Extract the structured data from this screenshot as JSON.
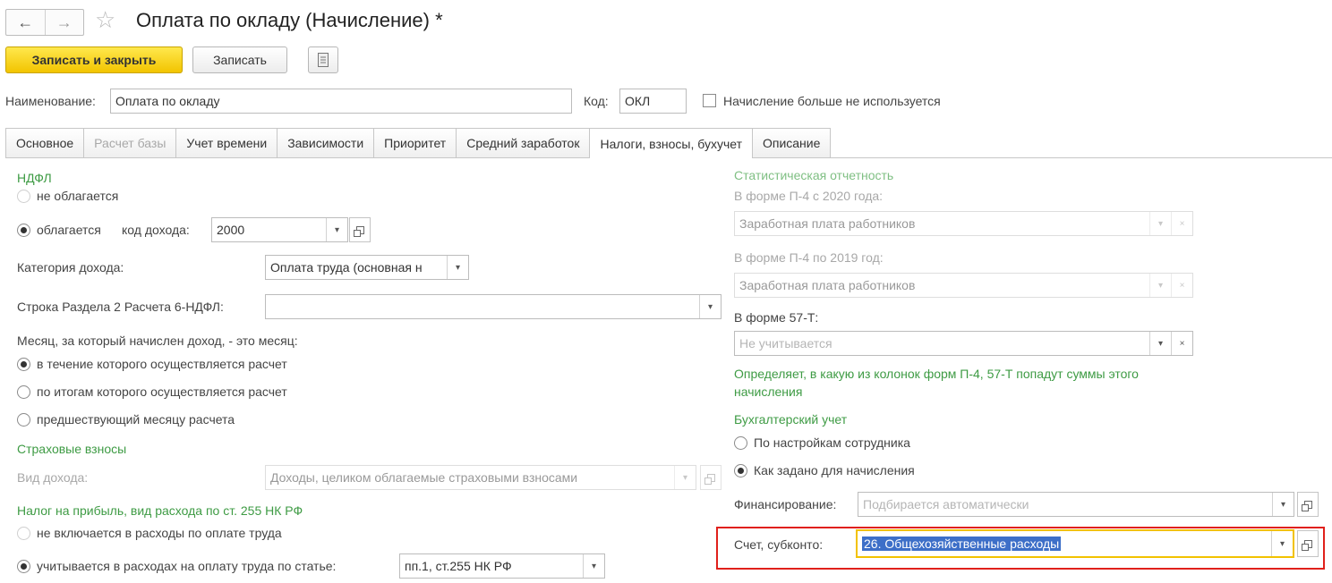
{
  "header": {
    "back_glyph": "←",
    "forward_glyph": "→",
    "star_glyph": "☆",
    "title": "Оплата по окладу (Начисление) *"
  },
  "toolbar": {
    "save_close_label": "Записать и закрыть",
    "save_label": "Записать",
    "more_icon": "document-list-icon"
  },
  "form": {
    "name_label": "Наименование:",
    "name_value": "Оплата по окладу",
    "code_label": "Код:",
    "code_value": "ОКЛ",
    "unused_label": "Начисление больше не используется"
  },
  "tabs": [
    {
      "label": "Основное"
    },
    {
      "label": "Расчет базы"
    },
    {
      "label": "Учет времени"
    },
    {
      "label": "Зависимости"
    },
    {
      "label": "Приоритет"
    },
    {
      "label": "Средний заработок"
    },
    {
      "label": "Налоги, взносы, бухучет"
    },
    {
      "label": "Описание"
    }
  ],
  "left": {
    "ndfl_title": "НДФЛ",
    "not_taxed": "не облагается",
    "taxed": "облагается",
    "income_code_label": "код дохода:",
    "income_code_value": "2000",
    "income_category_label": "Категория дохода:",
    "income_category_value": "Оплата труда (основная н",
    "row_label": "Строка Раздела 2 Расчета 6-НДФЛ:",
    "row_value": "",
    "month_question": "Месяц, за который начислен доход, - это месяц:",
    "month_options": [
      "в течение которого осуществляется расчет",
      "по итогам которого осуществляется расчет",
      "предшествующий месяцу расчета"
    ],
    "insurance_title": "Страховые взносы",
    "income_type_label": "Вид дохода:",
    "income_type_value": "Доходы, целиком облагаемые страховыми взносами",
    "profit_tax_title": "Налог на прибыль, вид расхода по ст. 255 НК РФ",
    "not_included": "не включается в расходы по оплате труда",
    "included": "учитывается в расходах на оплату труда по статье:",
    "article_value": "пп.1, ст.255 НК РФ"
  },
  "right": {
    "stat_title": "Статистическая отчетность",
    "p4_2020_label": "В форме П-4 с 2020 года:",
    "p4_2020_value": "Заработная плата работников",
    "p4_2019_label": "В форме П-4 по 2019 год:",
    "p4_2019_value": "Заработная плата работников",
    "f57_label": "В форме 57-Т:",
    "f57_placeholder": "Не учитывается",
    "note": "Определяет, в какую из колонок форм П-4, 57-Т попадут суммы этого начисления",
    "accounting_title": "Бухгалтерский учет",
    "acc_by_employee": "По настройкам сотрудника",
    "acc_as_set": "Как задано для начисления",
    "financing_label": "Финансирование:",
    "financing_placeholder": "Подбирается автоматически",
    "account_label": "Счет, субконто:",
    "account_value": "26. Общехозяйственные расходы"
  },
  "glyphs": {
    "dropdown": "▾",
    "clear": "×"
  },
  "colors": {
    "section_green": "#3e9b44",
    "primary_yellow": "#f2c400",
    "highlight_red": "#e0201b",
    "focus_yellow": "#f2c200",
    "selection_blue": "#3d6fc8"
  }
}
